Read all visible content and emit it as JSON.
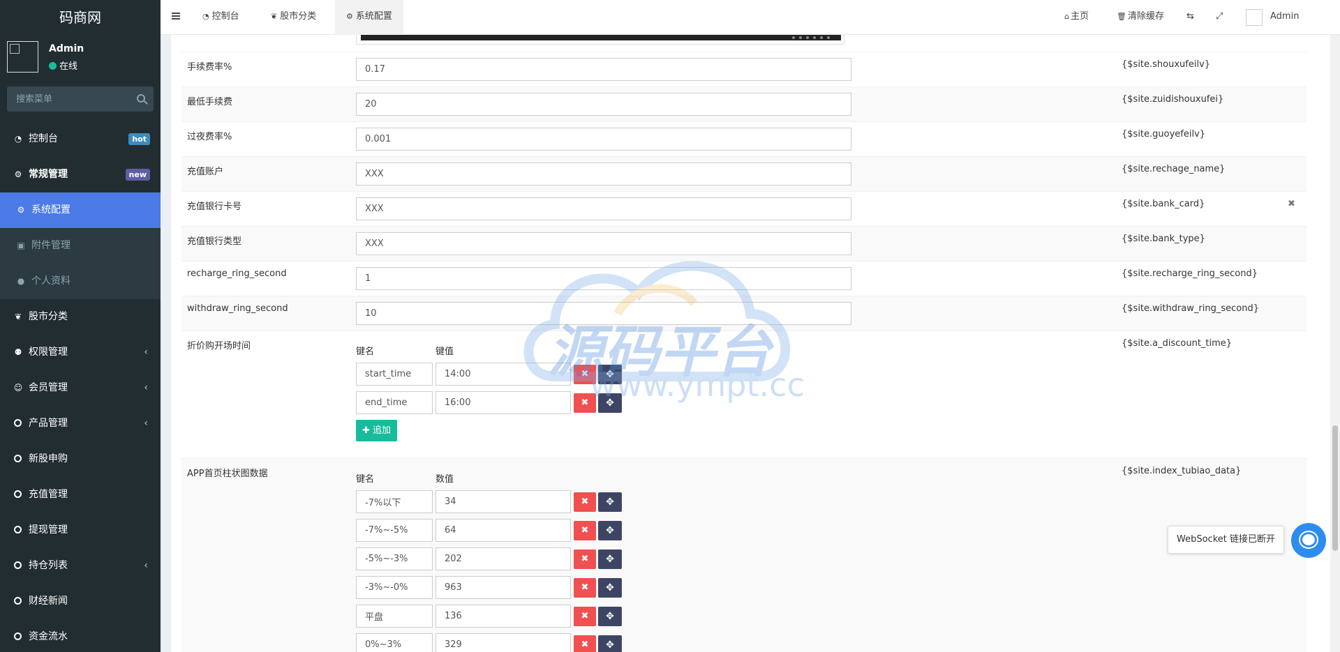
{
  "app": {
    "logo": "码商网"
  },
  "user": {
    "name": "Admin",
    "status": "在线"
  },
  "search": {
    "placeholder": "搜索菜单"
  },
  "sidebar": {
    "items": [
      {
        "label": "控制台",
        "badge": "hot",
        "badge_color": "#3c8dbc",
        "icon": "dashboard-icon"
      },
      {
        "label": "常规管理",
        "badge": "new",
        "badge_color": "#605ca8",
        "icon": "cogs-icon"
      },
      {
        "label": "股市分类",
        "icon": "leaf-icon"
      },
      {
        "label": "权限管理",
        "icon": "users-icon"
      },
      {
        "label": "会员管理",
        "icon": "user-circle-icon"
      },
      {
        "label": "产品管理",
        "icon": "circle-icon"
      },
      {
        "label": "新股申购",
        "icon": "circle-icon"
      },
      {
        "label": "充值管理",
        "icon": "circle-icon"
      },
      {
        "label": "提现管理",
        "icon": "circle-icon"
      },
      {
        "label": "持仓列表",
        "icon": "circle-icon"
      },
      {
        "label": "财经新闻",
        "icon": "circle-icon"
      },
      {
        "label": "资金流水",
        "icon": "circle-icon"
      }
    ],
    "submenu": [
      {
        "label": "系统配置",
        "icon": "gear-icon",
        "active": true
      },
      {
        "label": "附件管理",
        "icon": "image-icon"
      },
      {
        "label": "个人资料",
        "icon": "user-icon"
      }
    ],
    "arrow": "‹"
  },
  "header": {
    "tabs": [
      {
        "label": "控制台",
        "icon": "dashboard-icon"
      },
      {
        "label": "股市分类",
        "icon": "leaf-icon"
      },
      {
        "label": "系统配置",
        "icon": "gear-icon"
      }
    ],
    "home": "主页",
    "clear_cache": "清除缓存",
    "admin": "Admin"
  },
  "config": {
    "rows": [
      {
        "label": "手续费率%",
        "value": "0.17",
        "var": "{$site.shouxufeilv}"
      },
      {
        "label": "最低手续费",
        "value": "20",
        "var": "{$site.zuidishouxufei}"
      },
      {
        "label": "过夜费率%",
        "value": "0.001",
        "var": "{$site.guoyefeilv}"
      },
      {
        "label": "充值账户",
        "value": "XXX",
        "var": "{$site.rechage_name}"
      },
      {
        "label": "充值银行卡号",
        "value": "XXX",
        "var": "{$site.bank_card}"
      },
      {
        "label": "充值银行类型",
        "value": "XXX",
        "var": "{$site.bank_type}"
      },
      {
        "label": "recharge_ring_second",
        "value": "1",
        "var": "{$site.recharge_ring_second}"
      },
      {
        "label": "withdraw_ring_second",
        "value": "10",
        "var": "{$site.withdraw_ring_second}"
      }
    ],
    "discount": {
      "label": "折价购开场时间",
      "var": "{$site.a_discount_time}",
      "key_header": "键名",
      "val_header": "键值",
      "pairs": [
        {
          "key": "start_time",
          "value": "14:00"
        },
        {
          "key": "end_time",
          "value": "16:00"
        }
      ],
      "add_label": "✚ 追加"
    },
    "chart": {
      "label": "APP首页柱状图数据",
      "var": "{$site.index_tubiao_data}",
      "key_header": "键名",
      "val_header": "数值",
      "pairs": [
        {
          "key": "-7%以下",
          "value": "34"
        },
        {
          "key": "-7%~-5%",
          "value": "64"
        },
        {
          "key": "-5%~-3%",
          "value": "202"
        },
        {
          "key": "-3%~-0%",
          "value": "963"
        },
        {
          "key": "平盘",
          "value": "136"
        },
        {
          "key": "0%~3%",
          "value": "329"
        }
      ]
    }
  },
  "watermark": {
    "text": "源码平台",
    "url": "www.ympt.cc"
  },
  "toast": {
    "text": "WebSocket 链接已断开"
  }
}
